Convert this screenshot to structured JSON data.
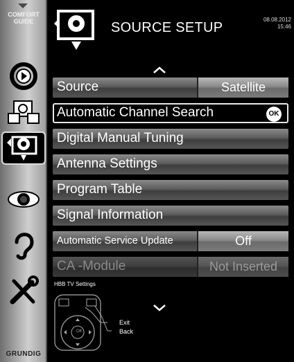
{
  "sidebar": {
    "comfort_guide": "COMFORT\nGUIDE",
    "comfort_line1": "COMFORT",
    "comfort_line2": "GUIDE",
    "icons": [
      "play-icon",
      "network-source-icon",
      "source-setup-icon",
      "eye-icon",
      "ear-icon",
      "tools-icon"
    ],
    "brand": "GRUNDIG"
  },
  "header": {
    "title": "SOURCE SETUP",
    "date": "08.08.2012",
    "time": "15:46"
  },
  "menu": {
    "items": [
      {
        "label": "Source",
        "value": "Satellite"
      },
      {
        "label": "Automatic Channel Search",
        "action": "OK"
      },
      {
        "label": "Digital Manual Tuning"
      },
      {
        "label": "Antenna Settings"
      },
      {
        "label": "Program Table"
      },
      {
        "label": "Signal Information"
      },
      {
        "label": "Automatic Service Update",
        "value": "Off"
      },
      {
        "label": "CA -Module",
        "value": "Not Inserted"
      }
    ],
    "footer_item": "HBB TV Settings"
  },
  "help": {
    "exit": "Exit",
    "back": "Back",
    "ok": "OK"
  },
  "colors": {
    "background": "#000000",
    "sidebar": "#a8a8a8",
    "highlight_border": "#e8e8e8"
  }
}
